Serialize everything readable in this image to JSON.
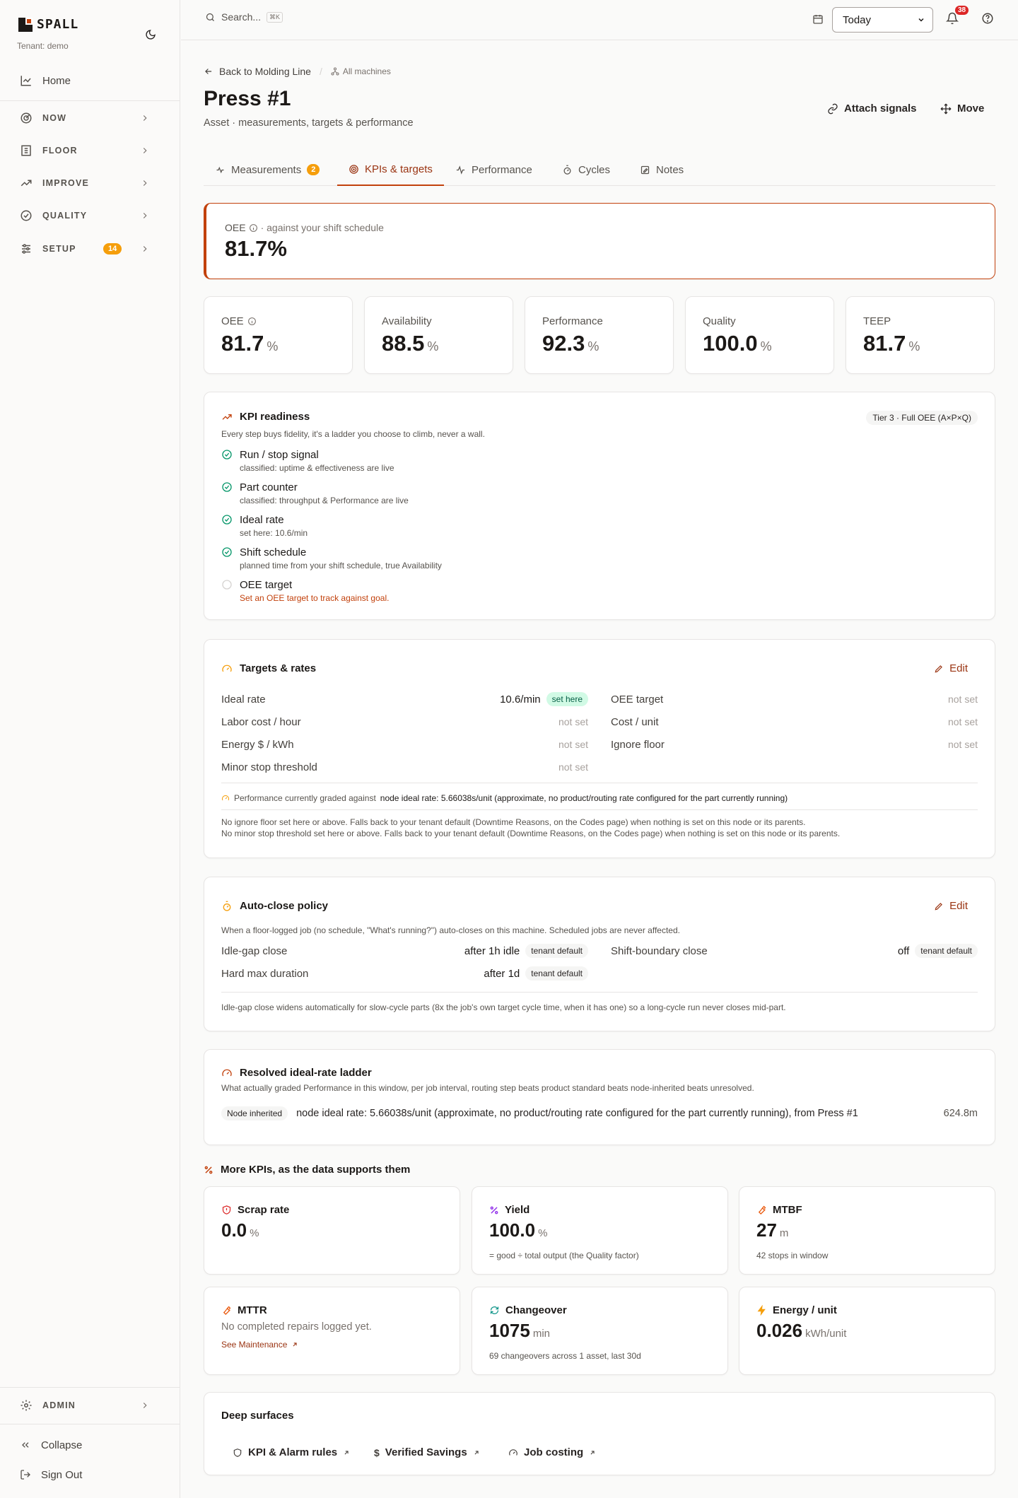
{
  "app": {
    "name": "SPALL",
    "tenant": "Tenant: demo"
  },
  "sidebar": {
    "home": "Home",
    "items": [
      {
        "label": "NOW"
      },
      {
        "label": "FLOOR"
      },
      {
        "label": "IMPROVE"
      },
      {
        "label": "QUALITY"
      },
      {
        "label": "SETUP",
        "badge": "14"
      }
    ],
    "admin": "ADMIN",
    "collapse": "Collapse",
    "signout": "Sign Out"
  },
  "topbar": {
    "search_placeholder": "Search...",
    "search_kbd": "⌘K",
    "date_range": "Today",
    "notifications_count": "38"
  },
  "header": {
    "back": "Back to Molding Line",
    "all_machines": "All machines",
    "title": "Press #1",
    "subtitle": "Asset · measurements, targets & performance",
    "attach": "Attach signals",
    "move": "Move"
  },
  "tabs": [
    {
      "label": "Measurements",
      "count": "2"
    },
    {
      "label": "KPIs & targets"
    },
    {
      "label": "Performance"
    },
    {
      "label": "Cycles"
    },
    {
      "label": "Notes"
    }
  ],
  "hero": {
    "label": "OEE",
    "context": "· against your shift schedule",
    "value": "81.7%"
  },
  "kpis": [
    {
      "label": "OEE",
      "value": "81.7",
      "unit": "%"
    },
    {
      "label": "Availability",
      "value": "88.5",
      "unit": "%"
    },
    {
      "label": "Performance",
      "value": "92.3",
      "unit": "%"
    },
    {
      "label": "Quality",
      "value": "100.0",
      "unit": "%"
    },
    {
      "label": "TEEP",
      "value": "81.7",
      "unit": "%"
    }
  ],
  "readiness": {
    "title": "KPI readiness",
    "tier": "Tier 3 · Full OEE (A×P×Q)",
    "desc": "Every step buys fidelity, it's a ladder you choose to climb, never a wall.",
    "items": [
      {
        "title": "Run / stop signal",
        "sub": "classified: uptime & effectiveness are live",
        "done": true
      },
      {
        "title": "Part counter",
        "sub": "classified: throughput & Performance are live",
        "done": true
      },
      {
        "title": "Ideal rate",
        "sub": "set here: 10.6/min",
        "done": true
      },
      {
        "title": "Shift schedule",
        "sub": "planned time from your shift schedule, true Availability",
        "done": true
      },
      {
        "title": "OEE target",
        "sub": "Set an OEE target to track against goal.",
        "done": false
      }
    ]
  },
  "targets": {
    "title": "Targets & rates",
    "edit": "Edit",
    "left": [
      {
        "label": "Ideal rate",
        "value": "10.6/min",
        "pill": "set here"
      },
      {
        "label": "Labor cost / hour",
        "value": "not set"
      },
      {
        "label": "Energy $ / kWh",
        "value": "not set"
      },
      {
        "label": "Minor stop threshold",
        "value": "not set"
      }
    ],
    "right": [
      {
        "label": "OEE target",
        "value": "not set"
      },
      {
        "label": "Cost / unit",
        "value": "not set"
      },
      {
        "label": "Ignore floor",
        "value": "not set"
      }
    ],
    "graded_prefix": "Performance currently graded against",
    "graded_value": "node ideal rate: 5.66038s/unit (approximate, no product/routing rate configured for the part currently running)",
    "note1": "No ignore floor set here or above. Falls back to your tenant default (Downtime Reasons, on the Codes page) when nothing is set on this node or its parents.",
    "note2": "No minor stop threshold set here or above. Falls back to your tenant default (Downtime Reasons, on the Codes page) when nothing is set on this node or its parents."
  },
  "autoclose": {
    "title": "Auto-close policy",
    "edit": "Edit",
    "desc": "When a floor-logged job (no schedule, \"What's running?\") auto-closes on this machine. Scheduled jobs are never affected.",
    "rows": [
      {
        "label": "Idle-gap close",
        "value": "after 1h idle",
        "pill": "tenant default"
      },
      {
        "label": "Hard max duration",
        "value": "after 1d",
        "pill": "tenant default"
      },
      {
        "label": "Shift-boundary close",
        "value": "off",
        "pill": "tenant default"
      }
    ],
    "note": "Idle-gap close widens automatically for slow-cycle parts (8x the job's own target cycle time, when it has one) so a long-cycle run never closes mid-part."
  },
  "ladder": {
    "title": "Resolved ideal-rate ladder",
    "desc": "What actually graded Performance in this window, per job interval, routing step beats product standard beats node-inherited beats unresolved.",
    "pill": "Node inherited",
    "text": "node ideal rate: 5.66038s/unit (approximate, no product/routing rate configured for the part currently running), from Press #1",
    "duration": "624.8m"
  },
  "more": {
    "title": "More KPIs, as the data supports them",
    "cards": [
      {
        "title": "Scrap rate",
        "value": "0.0",
        "unit": "%",
        "sub": ""
      },
      {
        "title": "Yield",
        "value": "100.0",
        "unit": "%",
        "sub": "= good ÷ total output (the Quality factor)"
      },
      {
        "title": "MTBF",
        "value": "27",
        "unit": "m",
        "sub": "42 stops in window"
      },
      {
        "title": "MTTR",
        "value": "",
        "unit": "",
        "sub": "No completed repairs logged yet.",
        "link": "See Maintenance"
      },
      {
        "title": "Changeover",
        "value": "1075",
        "unit": "min",
        "sub": "69 changeovers across 1 asset, last 30d"
      },
      {
        "title": "Energy / unit",
        "value": "0.026",
        "unit": "kWh/unit",
        "sub": ""
      }
    ]
  },
  "deep": {
    "title": "Deep surfaces",
    "links": [
      "KPI & Alarm rules",
      "Verified Savings",
      "Job costing"
    ]
  },
  "colors": {
    "accent": "#c2410c",
    "success": "#059669",
    "warning": "#f59e0b",
    "danger": "#dc2626"
  }
}
